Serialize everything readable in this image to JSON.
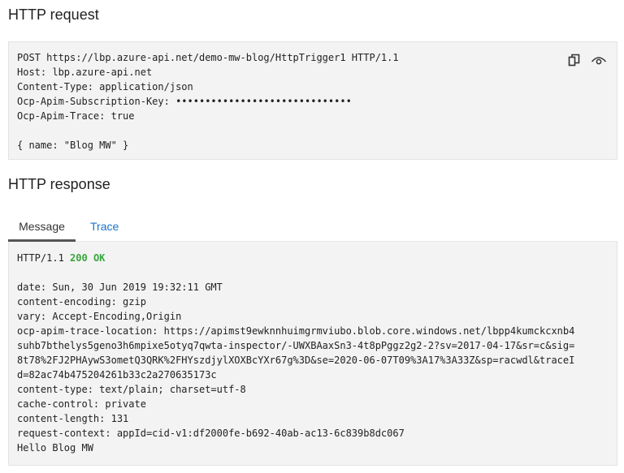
{
  "request": {
    "title": "HTTP request",
    "lines": [
      "POST https://lbp.azure-api.net/demo-mw-blog/HttpTrigger1 HTTP/1.1",
      "Host: lbp.azure-api.net",
      "Content-Type: application/json",
      "Ocp-Apim-Subscription-Key: ••••••••••••••••••••••••••••••",
      "Ocp-Apim-Trace: true",
      "",
      "{ name: \"Blog MW\" }"
    ],
    "icons": {
      "copy": "copy-icon",
      "reveal": "eye-icon"
    }
  },
  "response": {
    "title": "HTTP response",
    "tabs": [
      {
        "label": "Message",
        "active": true
      },
      {
        "label": "Trace",
        "active": false
      }
    ],
    "status": {
      "protocol": "HTTP/1.1",
      "code": "200",
      "text": "OK",
      "color": "#36a83b"
    },
    "lines": [
      "",
      "date: Sun, 30 Jun 2019 19:32:11 GMT",
      "content-encoding: gzip",
      "vary: Accept-Encoding,Origin",
      "ocp-apim-trace-location: https://apimst9ewknnhuimgrmviubo.blob.core.windows.net/lbpp4kumckcxnb4",
      "suhb7bthelys5geno3h6mpixe5otyq7qwta-inspector/-UWXBAaxSn3-4t8pPggz2g2-2?sv=2017-04-17&sr=c&sig=",
      "8t78%2FJ2PHAywS3ometQ3QRK%2FHYszdjylXOXBcYXr67g%3D&se=2020-06-07T09%3A17%3A33Z&sp=racwdl&traceI",
      "d=82ac74b475204261b33c2a270635173c",
      "content-type: text/plain; charset=utf-8",
      "cache-control: private",
      "content-length: 131",
      "request-context: appId=cid-v1:df2000fe-b692-40ab-ac13-6c839b8dc067",
      "Hello Blog MW"
    ]
  }
}
